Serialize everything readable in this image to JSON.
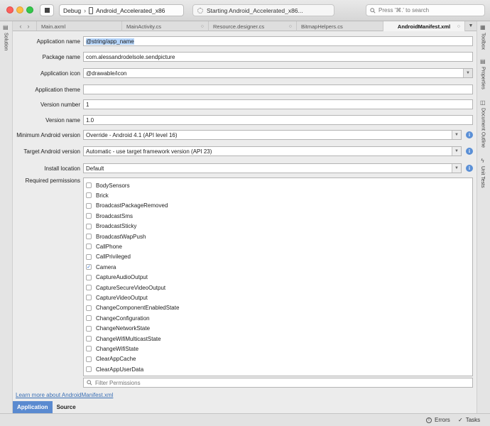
{
  "toolbar": {
    "configuration": "Debug",
    "separator": "›",
    "device": "Android_Accelerated_x86",
    "status": "Starting Android_Accelerated_x86...",
    "search_placeholder": "Press '⌘.' to search"
  },
  "side_panels": {
    "left": [
      "Solution"
    ],
    "right": [
      "Toolbox",
      "Properties",
      "Document Outline",
      "Unit Tests"
    ]
  },
  "tabs": [
    {
      "label": "Main.axml"
    },
    {
      "label": "MainActivity.cs"
    },
    {
      "label": "Resource.designer.cs"
    },
    {
      "label": "BitmapHelpers.cs"
    },
    {
      "label": "AndroidManifest.xml"
    }
  ],
  "form": {
    "app_name_label": "Application name",
    "app_name_value": "@string/app_name",
    "package_label": "Package name",
    "package_value": "com.alessandrodelsole.sendpicture",
    "icon_label": "Application icon",
    "icon_value": "@drawable/icon",
    "theme_label": "Application theme",
    "theme_value": "",
    "version_number_label": "Version number",
    "version_number_value": "1",
    "version_name_label": "Version name",
    "version_name_value": "1.0",
    "min_android_label": "Minimum Android version",
    "min_android_value": "Override - Android 4.1 (API level 16)",
    "target_android_label": "Target Android version",
    "target_android_value": "Automatic - use target framework version (API 23)",
    "install_location_label": "Install location",
    "install_location_value": "Default",
    "permissions_label": "Required permissions",
    "filter_placeholder": "Filter Permissions"
  },
  "permissions": [
    {
      "name": "BodySensors",
      "checked": false
    },
    {
      "name": "Brick",
      "checked": false
    },
    {
      "name": "BroadcastPackageRemoved",
      "checked": false
    },
    {
      "name": "BroadcastSms",
      "checked": false
    },
    {
      "name": "BroadcastSticky",
      "checked": false
    },
    {
      "name": "BroadcastWapPush",
      "checked": false
    },
    {
      "name": "CallPhone",
      "checked": false
    },
    {
      "name": "CallPrivileged",
      "checked": false
    },
    {
      "name": "Camera",
      "checked": true
    },
    {
      "name": "CaptureAudioOutput",
      "checked": false
    },
    {
      "name": "CaptureSecureVideoOutput",
      "checked": false
    },
    {
      "name": "CaptureVideoOutput",
      "checked": false
    },
    {
      "name": "ChangeComponentEnabledState",
      "checked": false
    },
    {
      "name": "ChangeConfiguration",
      "checked": false
    },
    {
      "name": "ChangeNetworkState",
      "checked": false
    },
    {
      "name": "ChangeWifiMulticastState",
      "checked": false
    },
    {
      "name": "ChangeWifiState",
      "checked": false
    },
    {
      "name": "ClearAppCache",
      "checked": false
    },
    {
      "name": "ClearAppUserData",
      "checked": false
    }
  ],
  "learn_more": "Learn more about AndroidManifest.xml",
  "bottom_tabs": [
    {
      "label": "Application",
      "active": true
    },
    {
      "label": "Source",
      "active": false
    }
  ],
  "statusbar": {
    "errors": "Errors",
    "tasks": "Tasks"
  }
}
